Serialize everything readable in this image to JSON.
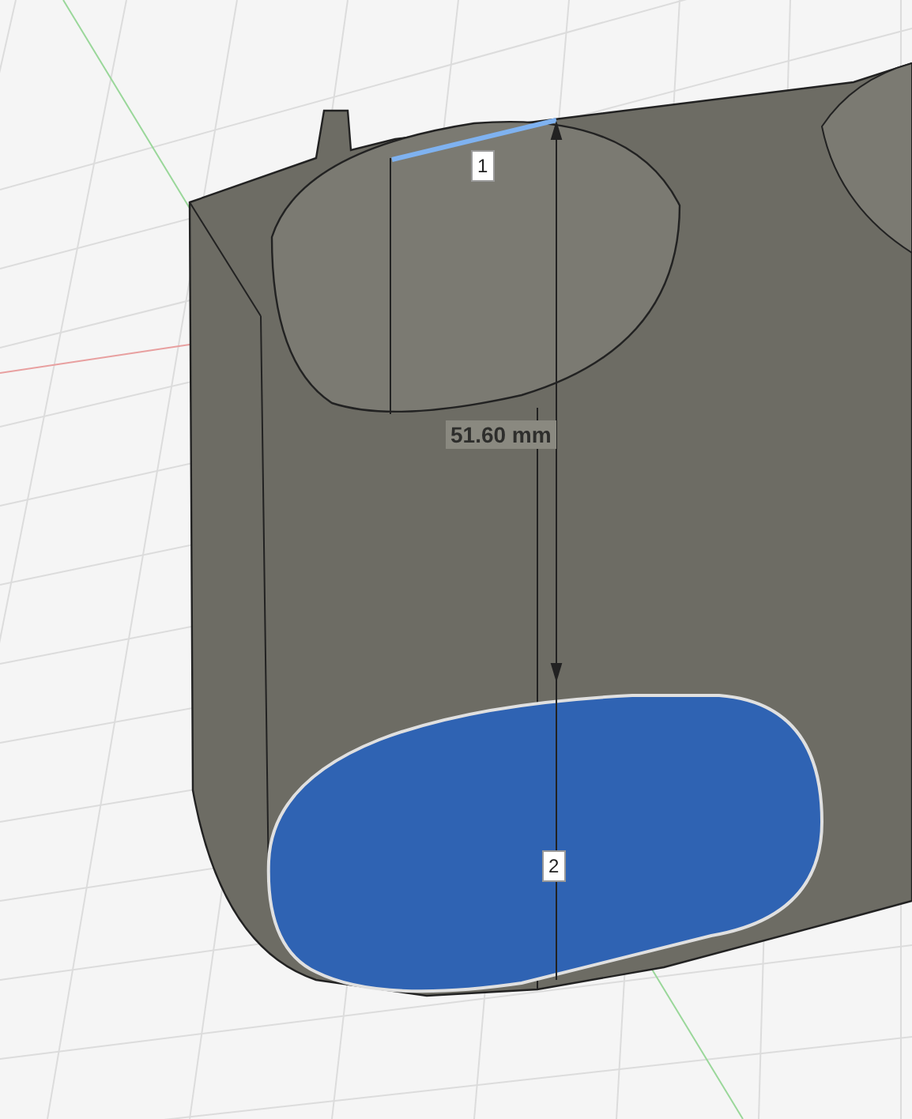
{
  "viewport": {
    "measurement": "51.60 mm",
    "markers": [
      "1",
      "2"
    ]
  }
}
